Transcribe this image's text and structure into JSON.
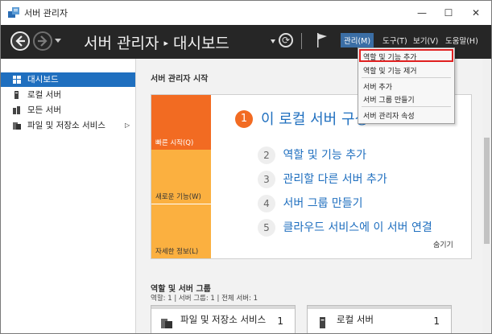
{
  "window": {
    "title": "서버 관리자",
    "minimize": "—",
    "maximize": "☐",
    "close": "✕"
  },
  "header": {
    "breadcrumb_root": "서버 관리자",
    "breadcrumb_sep": "▸",
    "breadcrumb_current": "대시보드",
    "refresh": "⟳",
    "menus": [
      "관리(M)",
      "도구(T)",
      "보기(V)",
      "도움말(H)"
    ]
  },
  "manage_menu": {
    "items": [
      "역할 및 기능 추가",
      "역할 및 기능 제거",
      "서버 추가",
      "서버 그룹 만들기",
      "서버 관리자 속성"
    ]
  },
  "sidebar": {
    "items": [
      {
        "label": "대시보드",
        "selected": true,
        "icon": "dashboard-icon"
      },
      {
        "label": "로컬 서버",
        "selected": false,
        "icon": "local-server-icon"
      },
      {
        "label": "모든 서버",
        "selected": false,
        "icon": "all-servers-icon"
      },
      {
        "label": "파일 및 저장소 서비스",
        "selected": false,
        "icon": "file-storage-icon",
        "expand": "▷"
      }
    ]
  },
  "dashboard": {
    "section_title": "서버 관리자 시작",
    "tiles": [
      {
        "label": "빠른 시작(Q)",
        "color": "#f26b22"
      },
      {
        "label": "새로운 기능(W)",
        "color": "#fbb040"
      },
      {
        "label": "자세한 정보(L)",
        "color": "#fbb040"
      }
    ],
    "step1": {
      "num": "1",
      "text": "이 로컬 서버 구성"
    },
    "steps": [
      {
        "num": "2",
        "text": "역할 및 기능 추가"
      },
      {
        "num": "3",
        "text": "관리할 다른 서버 추가"
      },
      {
        "num": "4",
        "text": "서버 그룹 만들기"
      },
      {
        "num": "5",
        "text": "클라우드 서비스에 이 서버 연결"
      }
    ],
    "hide": "숨기기"
  },
  "roles": {
    "title": "역할 및 서버 그룹",
    "summary": "역할: 1   |   서버 그룹: 1   |   전체 서버: 1",
    "cards": [
      {
        "name": "파일 및 저장소 서비스",
        "count": "1",
        "icon": "file-storage-icon"
      },
      {
        "name": "로컬 서버",
        "count": "1",
        "icon": "local-server-icon"
      }
    ]
  }
}
